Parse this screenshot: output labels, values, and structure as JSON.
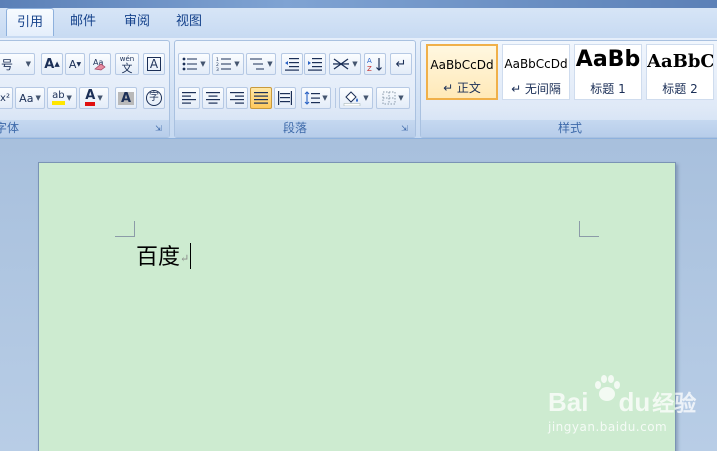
{
  "tabs": [
    {
      "label": "引用",
      "active": true
    },
    {
      "label": "邮件",
      "active": false
    },
    {
      "label": "审阅",
      "active": false
    },
    {
      "label": "视图",
      "active": false
    }
  ],
  "font_group": {
    "label": "字体",
    "size_combo_value": "号",
    "grow_font": "A",
    "shrink_font": "A",
    "phonetic_guide": "wén",
    "char_border": "A",
    "enclose_char": "字",
    "superscript_label": "x²",
    "change_case": "Aa",
    "highlight": "ab",
    "font_color": "A",
    "char_shading": "A"
  },
  "paragraph_group": {
    "label": "段落"
  },
  "styles_group": {
    "label": "样式",
    "items": [
      {
        "sample": "AaBbCcDd",
        "name": "↵ 正文",
        "selected": true
      },
      {
        "sample": "AaBbCcDd",
        "name": "↵ 无间隔",
        "selected": false
      },
      {
        "sample": "AaBb",
        "name": "标题 1",
        "selected": false
      },
      {
        "sample": "AaBbC",
        "name": "标题 2",
        "selected": false
      }
    ]
  },
  "document": {
    "text": "百度",
    "page_color": "#cdebd0"
  },
  "watermark": {
    "logo": "Bai",
    "logo_tail": "经验",
    "url": "jingyan.baidu.com"
  },
  "colors": {
    "ribbon_text": "#15428b",
    "selected_style_border": "#f0b04a",
    "highlight_button": "#ffc95c"
  }
}
